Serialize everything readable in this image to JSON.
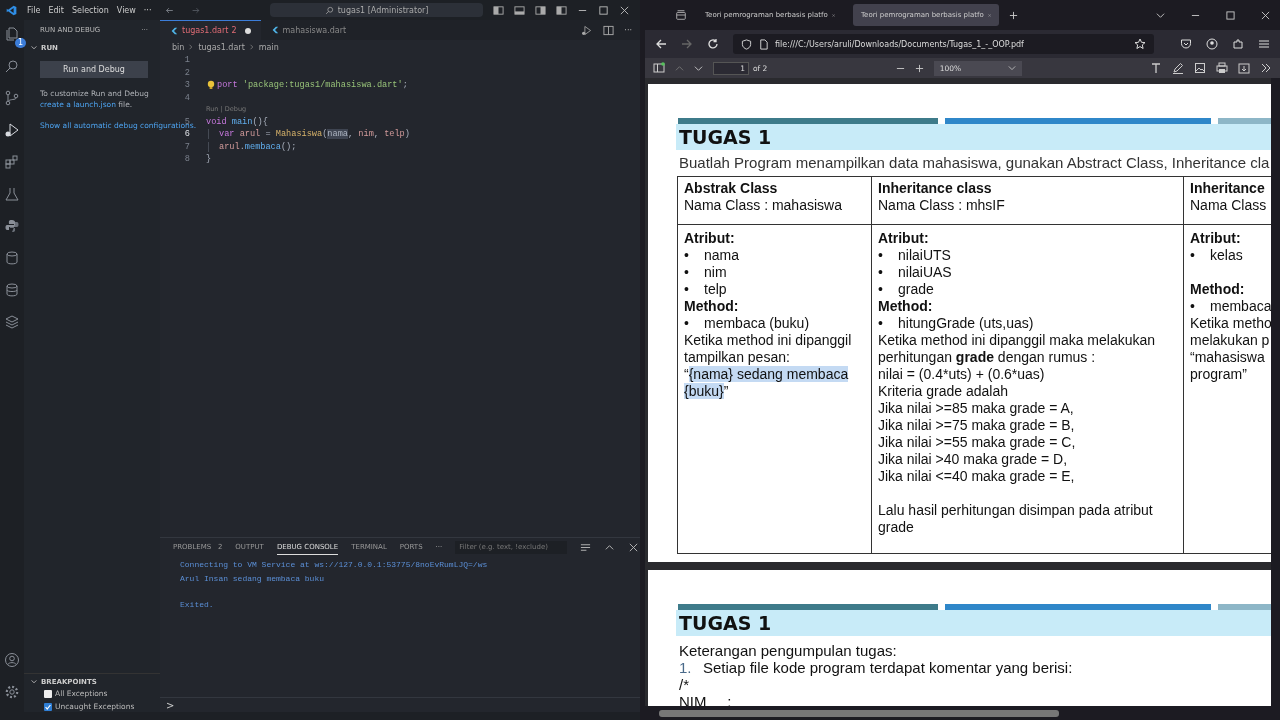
{
  "vscode": {
    "menu": [
      "File",
      "Edit",
      "Selection",
      "View",
      "···"
    ],
    "command_center": "tugas1 [Administrator]",
    "activity_badge": "1",
    "sidebar": {
      "title": "RUN AND DEBUG",
      "more": "···",
      "section": "RUN",
      "section_expanded": true,
      "button": "Run and Debug",
      "help": {
        "before": "To customize Run and Debug ",
        "link": "create a launch.json",
        "after": " file."
      },
      "link2": "Show all automatic debug configurations.",
      "breakpoints": {
        "title": "BREAKPOINTS",
        "expanded": true,
        "items": [
          {
            "label": "All Exceptions",
            "checked": false
          },
          {
            "label": "Uncaught Exceptions",
            "checked": true
          }
        ]
      }
    },
    "tabs": [
      {
        "label": "tugas1.dart",
        "badge": "2",
        "dirty": true,
        "selected": true
      },
      {
        "label": "mahasiswa.dart",
        "dirty": false,
        "selected": false
      }
    ],
    "breadcrumbs": [
      "bin",
      "tugas1.dart",
      "main"
    ],
    "code": [
      {
        "kind": "line",
        "number": "1",
        "current": false
      },
      {
        "kind": "line",
        "number": "2",
        "current": false
      },
      {
        "kind": "line",
        "number": "3",
        "current": false,
        "lightbulb": true,
        "tokens": [
          {
            "t": "port ",
            "kind": "kw"
          },
          {
            "t": "'package:tugas1/mahasiswa.dart'",
            "kind": "str"
          },
          {
            "t": ";",
            "kind": "punc"
          }
        ]
      },
      {
        "kind": "line",
        "number": "4",
        "current": false
      },
      {
        "kind": "codelens",
        "text": "Run | Debug"
      },
      {
        "kind": "line",
        "number": "5",
        "current": false,
        "tokens": [
          {
            "t": "void ",
            "kind": "kw"
          },
          {
            "t": "main",
            "kind": "fn"
          },
          {
            "t": "(){",
            "kind": "punc"
          }
        ]
      },
      {
        "kind": "line",
        "number": "6",
        "current": true,
        "indented": true,
        "tokens": [
          {
            "t": "var ",
            "kind": "kw"
          },
          {
            "t": "arul",
            "kind": "var"
          },
          {
            "t": " = ",
            "kind": "punc"
          },
          {
            "t": "Mahasiswa",
            "kind": "cls"
          },
          {
            "t": "(",
            "kind": "punc"
          },
          {
            "t": "nama",
            "kind": "sel"
          },
          {
            "t": ", ",
            "kind": "punc"
          },
          {
            "t": "nim",
            "kind": "var"
          },
          {
            "t": ", ",
            "kind": "punc"
          },
          {
            "t": "telp",
            "kind": "var"
          },
          {
            "t": ")",
            "kind": "punc"
          }
        ]
      },
      {
        "kind": "line",
        "number": "7",
        "current": false,
        "indented": true,
        "tokens": [
          {
            "t": "arul",
            "kind": "var"
          },
          {
            "t": ".",
            "kind": "punc"
          },
          {
            "t": "membaca",
            "kind": "fn"
          },
          {
            "t": "();",
            "kind": "punc"
          }
        ]
      },
      {
        "kind": "line",
        "number": "8",
        "current": false,
        "tokens": [
          {
            "t": "}",
            "kind": "punc"
          }
        ]
      }
    ],
    "panel": {
      "tabs": [
        {
          "label": "PROBLEMS",
          "count": "2",
          "selected": false
        },
        {
          "label": "OUTPUT",
          "selected": false
        },
        {
          "label": "DEBUG CONSOLE",
          "selected": true
        },
        {
          "label": "TERMINAL",
          "selected": false
        },
        {
          "label": "PORTS",
          "selected": false
        }
      ],
      "more": "···",
      "filter_placeholder": "Filter (e.g. text, !exclude)",
      "console": [
        "Connecting to VM Service at ws://127.0.0.1:53775/8noEvRumLJQ=/ws",
        "Arul Insan sedang membaca buku"
      ],
      "exit_message": "Exited.",
      "prompt": ">"
    }
  },
  "browser": {
    "tabs": [
      {
        "title": "Teori pemrograman berbasis platfo",
        "selected": false
      },
      {
        "title": "Teori pemrograman berbasis platfo",
        "selected": true
      }
    ],
    "url": "file:///C:/Users/aruli/Downloads/Documents/Tugas_1_-_OOP.pdf",
    "pdf_toolbar": {
      "page": "1",
      "page_count": "of 2",
      "zoom": "100%"
    },
    "pages": [
      {
        "title": "TUGAS 1",
        "intro": "Buatlah Program menampilkan data mahasiswa, gunakan Abstract Class, Inheritance cla",
        "table": [
          {
            "title": "Abstrak Class",
            "subtitle": "Nama Class : mahasiswa",
            "body": [
              {
                "kind": "heading",
                "text": "Atribut:"
              },
              {
                "kind": "bullet",
                "marker": "•",
                "text": "nama"
              },
              {
                "kind": "bullet",
                "marker": "•",
                "text": "nim"
              },
              {
                "kind": "bullet",
                "marker": "•",
                "text": "telp"
              },
              {
                "kind": "heading",
                "text": "Method:"
              },
              {
                "kind": "bullet",
                "marker": "•",
                "text": "membaca (buku)"
              },
              {
                "kind": "text",
                "text": "Ketika method ini dipanggil tampilkan pesan:"
              },
              {
                "kind": "selection",
                "before": "“",
                "text": "{nama} sedang membaca {buku}",
                "after": "”"
              }
            ]
          },
          {
            "title": "Inheritance class",
            "subtitle": "Nama Class : mhsIF",
            "body": [
              {
                "kind": "heading",
                "text": "Atribut:"
              },
              {
                "kind": "bullet",
                "marker": "•",
                "text": "nilaiUTS"
              },
              {
                "kind": "bullet",
                "marker": "•",
                "text": "nilaiUAS"
              },
              {
                "kind": "bullet",
                "marker": "•",
                "text": "grade"
              },
              {
                "kind": "heading",
                "text": "Method:"
              },
              {
                "kind": "bullet",
                "marker": "•",
                "text": "hitungGrade (uts,uas)"
              },
              {
                "kind": "rich",
                "text": "Ketika method ini dipanggil maka melakukan perhitungan **grade** dengan rumus :"
              },
              {
                "kind": "text",
                "text": "nilai = (0.4*uts) + (0.6*uas)"
              },
              {
                "kind": "text",
                "text": "Kriteria grade adalah"
              },
              {
                "kind": "text",
                "text": "Jika nilai >=85 maka grade = A,"
              },
              {
                "kind": "text",
                "text": "Jika nilai >=75 maka grade = B,"
              },
              {
                "kind": "text",
                "text": "Jika nilai >=55 maka grade = C,"
              },
              {
                "kind": "text",
                "text": "Jika nilai >40 maka grade = D,"
              },
              {
                "kind": "text",
                "text": "Jika nilai <=40 maka grade = E,"
              },
              {
                "kind": "gap"
              },
              {
                "kind": "text",
                "text": "Lalu hasil perhitungan disimpan pada atribut grade"
              }
            ]
          },
          {
            "title": "Inheritance",
            "subtitle": "Nama Class",
            "body": [
              {
                "kind": "heading",
                "text": "Atribut:"
              },
              {
                "kind": "bullet",
                "marker": "•",
                "text": "kelas"
              },
              {
                "kind": "gap"
              },
              {
                "kind": "heading",
                "text": "Method:"
              },
              {
                "kind": "bullet",
                "marker": "•",
                "text": "membaca"
              },
              {
                "kind": "text",
                "text": "Ketika metho"
              },
              {
                "kind": "text",
                "text": "melakukan p"
              },
              {
                "kind": "text",
                "text": "“mahasiswa"
              },
              {
                "kind": "text",
                "text": "program”"
              }
            ]
          }
        ]
      },
      {
        "title": "TUGAS 1",
        "lines": [
          {
            "kind": "text",
            "text": "Keterangan pengumpulan tugas:"
          },
          {
            "kind": "numbered",
            "marker": "1.",
            "text": "Setiap file kode program terdapat komentar yang berisi:"
          },
          {
            "kind": "text",
            "text": "/*"
          },
          {
            "kind": "text",
            "text": "NIM     :"
          }
        ]
      }
    ]
  }
}
